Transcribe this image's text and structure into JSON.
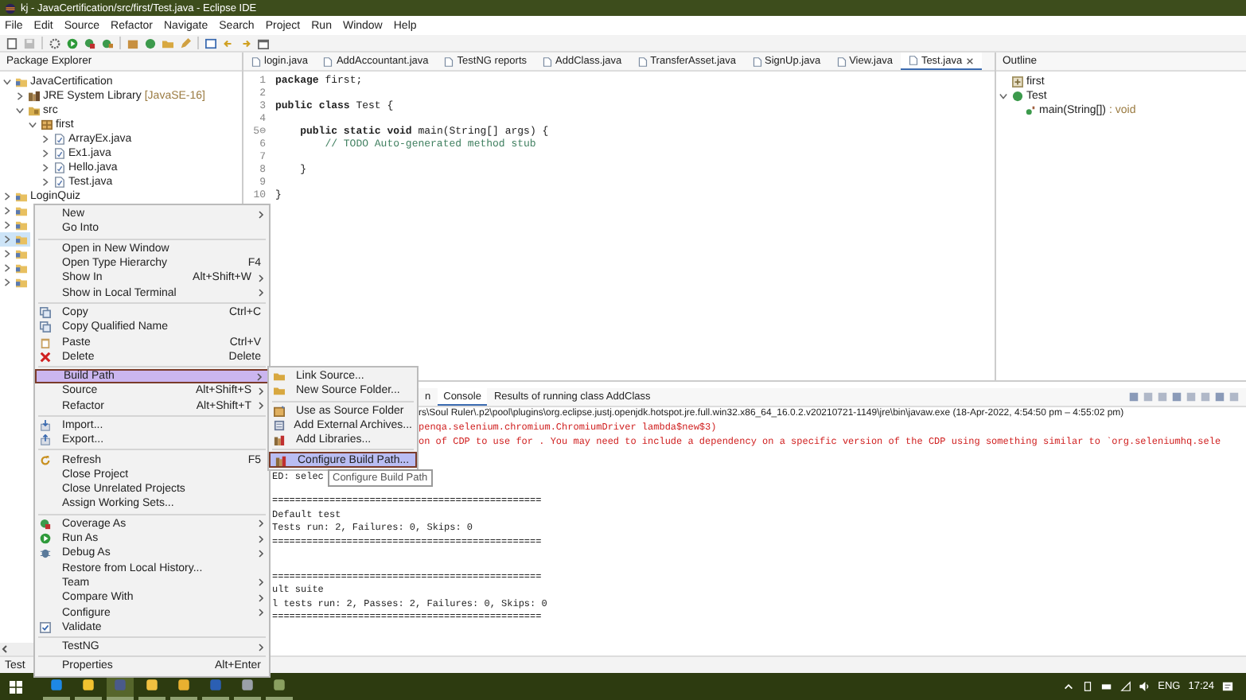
{
  "window": {
    "title": "kj - JavaCertification/src/first/Test.java - Eclipse IDE"
  },
  "menu_bar": [
    "File",
    "Edit",
    "Source",
    "Refactor",
    "Navigate",
    "Search",
    "Project",
    "Run",
    "Window",
    "Help"
  ],
  "package_explorer": {
    "title": "Package Explorer",
    "tree": [
      {
        "name": "JavaCertification",
        "kind": "project",
        "expanded": true,
        "selected": false,
        "children": [
          {
            "name": "JRE System Library",
            "decoration": "[JavaSE-16]",
            "kind": "library",
            "expanded": false,
            "selected": false
          },
          {
            "name": "src",
            "kind": "source",
            "expanded": true,
            "selected": false,
            "children": [
              {
                "name": "first",
                "kind": "package",
                "expanded": true,
                "selected": false,
                "children": [
                  {
                    "name": "ArrayEx.java",
                    "kind": "file",
                    "expanded": false,
                    "selected": false
                  },
                  {
                    "name": "Ex1.java",
                    "kind": "file",
                    "expanded": false,
                    "selected": false
                  },
                  {
                    "name": "Hello.java",
                    "kind": "file",
                    "expanded": false,
                    "selected": false
                  },
                  {
                    "name": "Test.java",
                    "kind": "file",
                    "expanded": false,
                    "selected": false
                  }
                ]
              }
            ]
          }
        ]
      },
      {
        "name": "LoginQuiz",
        "kind": "project",
        "expanded": false,
        "selected": false
      },
      {
        "kind": "project",
        "expanded": false,
        "selected": false
      },
      {
        "kind": "project",
        "expanded": false,
        "selected": false
      },
      {
        "kind": "project",
        "expanded": false,
        "selected": true
      },
      {
        "kind": "project",
        "expanded": false,
        "selected": false
      },
      {
        "kind": "project",
        "expanded": false,
        "selected": false
      },
      {
        "kind": "project",
        "expanded": false,
        "selected": false
      }
    ]
  },
  "editor": {
    "tabs": [
      {
        "label": "login.java",
        "selected": false
      },
      {
        "label": "AddAccountant.java",
        "selected": false
      },
      {
        "label": "TestNG reports",
        "selected": false
      },
      {
        "label": "AddClass.java",
        "selected": false
      },
      {
        "label": "TransferAsset.java",
        "selected": false
      },
      {
        "label": "SignUp.java",
        "selected": false
      },
      {
        "label": "View.java",
        "selected": false
      },
      {
        "label": "Test.java",
        "selected": true
      }
    ],
    "lines": [
      {
        "number": "1",
        "code": "**package** first;",
        "kind": "code"
      },
      {
        "number": "2"
      },
      {
        "number": "3",
        "code": "**public** **class** Test {",
        "kind": "code"
      },
      {
        "number": "4"
      },
      {
        "number": "5⊖",
        "code": "    **public** **static** **void** main(String[] args) {",
        "kind": "code"
      },
      {
        "number": "6",
        "code": "        // TODO Auto-generated method stub",
        "kind": "comment"
      },
      {
        "number": "7"
      },
      {
        "number": "8",
        "code": "    }",
        "kind": "code"
      },
      {
        "number": "9"
      },
      {
        "number": "10",
        "code": "}",
        "kind": "code"
      }
    ]
  },
  "outline": {
    "title": "Outline",
    "tree": [
      {
        "name": "first",
        "kind": "import"
      },
      {
        "name": "Test",
        "kind": "class",
        "expanded": true,
        "children": [
          {
            "name": "main(String[])",
            "decoration": ": void",
            "kind": "method"
          }
        ]
      }
    ]
  },
  "console": {
    "tabs": [
      {
        "label": "n",
        "selected": false
      },
      {
        "label": "Console",
        "selected": true
      },
      {
        "label": "Results of running class AddClass",
        "selected": false
      }
    ],
    "path": "rs\\Soul Ruler\\.p2\\pool\\plugins\\org.eclipse.justj.openjdk.hotspot.jre.full.win32.x86_64_16.0.2.v20210721-1149\\jre\\bin\\javaw.exe  (18-Apr-2022, 4:54:50 pm – 4:55:02 pm)",
    "error_lines": [
      "penqa.selenium.chromium.ChromiumDriver lambda$new$3)",
      "on of CDP to use for . You may need to include a dependency on a specific version of the CDP using something similar to `org.seleniumhq.sele"
    ],
    "output_blocks": [
      [
        "ED: selec"
      ],
      [
        "===============================================",
        "Default test",
        "Tests run: 2, Failures: 0, Skips: 0",
        "==============================================="
      ],
      [
        "===============================================",
        "ult suite",
        "l tests run: 2, Passes: 2, Failures: 0, Skips: 0",
        "==============================================="
      ]
    ]
  },
  "context_menu": {
    "groups": [
      [
        {
          "label": "New",
          "submenu": true,
          "selected": false
        },
        {
          "label": "Go Into",
          "submenu": false,
          "selected": false
        }
      ],
      [
        {
          "label": "Open in New Window",
          "submenu": false,
          "selected": false
        },
        {
          "label": "Open Type Hierarchy",
          "shortcut": "F4",
          "submenu": false,
          "selected": false
        },
        {
          "label": "Show In",
          "shortcut": "Alt+Shift+W",
          "submenu": true,
          "selected": false
        },
        {
          "label": "Show in Local Terminal",
          "submenu": true,
          "selected": false
        }
      ],
      [
        {
          "label": "Copy",
          "shortcut": "Ctrl+C",
          "kind": "copy",
          "submenu": false,
          "selected": false
        },
        {
          "label": "Copy Qualified Name",
          "kind": "copy",
          "submenu": false,
          "selected": false
        },
        {
          "label": "Paste",
          "shortcut": "Ctrl+V",
          "kind": "paste",
          "submenu": false,
          "selected": false
        },
        {
          "label": "Delete",
          "shortcut": "Delete",
          "kind": "delete",
          "submenu": false,
          "selected": false
        }
      ],
      [
        {
          "label": "Build Path",
          "submenu": true,
          "selected": true
        },
        {
          "label": "Source",
          "shortcut": "Alt+Shift+S",
          "submenu": true,
          "selected": false
        },
        {
          "label": "Refactor",
          "shortcut": "Alt+Shift+T",
          "submenu": true,
          "selected": false
        }
      ],
      [
        {
          "label": "Import...",
          "kind": "import",
          "submenu": false,
          "selected": false
        },
        {
          "label": "Export...",
          "kind": "export",
          "submenu": false,
          "selected": false
        }
      ],
      [
        {
          "label": "Refresh",
          "shortcut": "F5",
          "kind": "refresh",
          "submenu": false,
          "selected": false
        },
        {
          "label": "Close Project",
          "submenu": false,
          "selected": false
        },
        {
          "label": "Close Unrelated Projects",
          "submenu": false,
          "selected": false
        },
        {
          "label": "Assign Working Sets...",
          "submenu": false,
          "selected": false
        }
      ],
      [
        {
          "label": "Coverage As",
          "kind": "coverage",
          "submenu": true,
          "selected": false
        },
        {
          "label": "Run As",
          "kind": "run",
          "submenu": true,
          "selected": false
        },
        {
          "label": "Debug As",
          "kind": "debug",
          "submenu": true,
          "selected": false
        },
        {
          "label": "Restore from Local History...",
          "submenu": false,
          "selected": false
        },
        {
          "label": "Team",
          "submenu": true,
          "selected": false
        },
        {
          "label": "Compare With",
          "submenu": true,
          "selected": false
        },
        {
          "label": "Configure",
          "submenu": true,
          "selected": false
        },
        {
          "label": "Validate",
          "kind": "validate",
          "submenu": false,
          "selected": false
        }
      ],
      [
        {
          "label": "TestNG",
          "submenu": true,
          "selected": false
        }
      ],
      [
        {
          "label": "Properties",
          "shortcut": "Alt+Enter",
          "submenu": false,
          "selected": false
        }
      ]
    ]
  },
  "submenu": {
    "groups": [
      [
        {
          "label": "Link Source...",
          "kind": "folder",
          "selected": false
        },
        {
          "label": "New Source Folder...",
          "kind": "folder",
          "selected": false
        }
      ],
      [
        {
          "label": "Use as Source Folder",
          "kind": "package",
          "selected": false
        },
        {
          "label": "Add External Archives...",
          "kind": "jar",
          "selected": false
        },
        {
          "label": "Add Libraries...",
          "kind": "library",
          "selected": false
        }
      ],
      [
        {
          "label": "Configure Build Path...",
          "kind": "library",
          "selected": true
        }
      ]
    ]
  },
  "tooltip": "Configure Build Path",
  "status_bar": {
    "text": "Test"
  },
  "taskbar": {
    "apps": [
      {
        "selected": false
      },
      {
        "selected": false
      },
      {
        "selected": true
      },
      {
        "selected": false
      },
      {
        "selected": false
      },
      {
        "selected": false
      },
      {
        "selected": false
      },
      {
        "selected": false
      }
    ],
    "language": "ENG",
    "time": "17:24"
  }
}
